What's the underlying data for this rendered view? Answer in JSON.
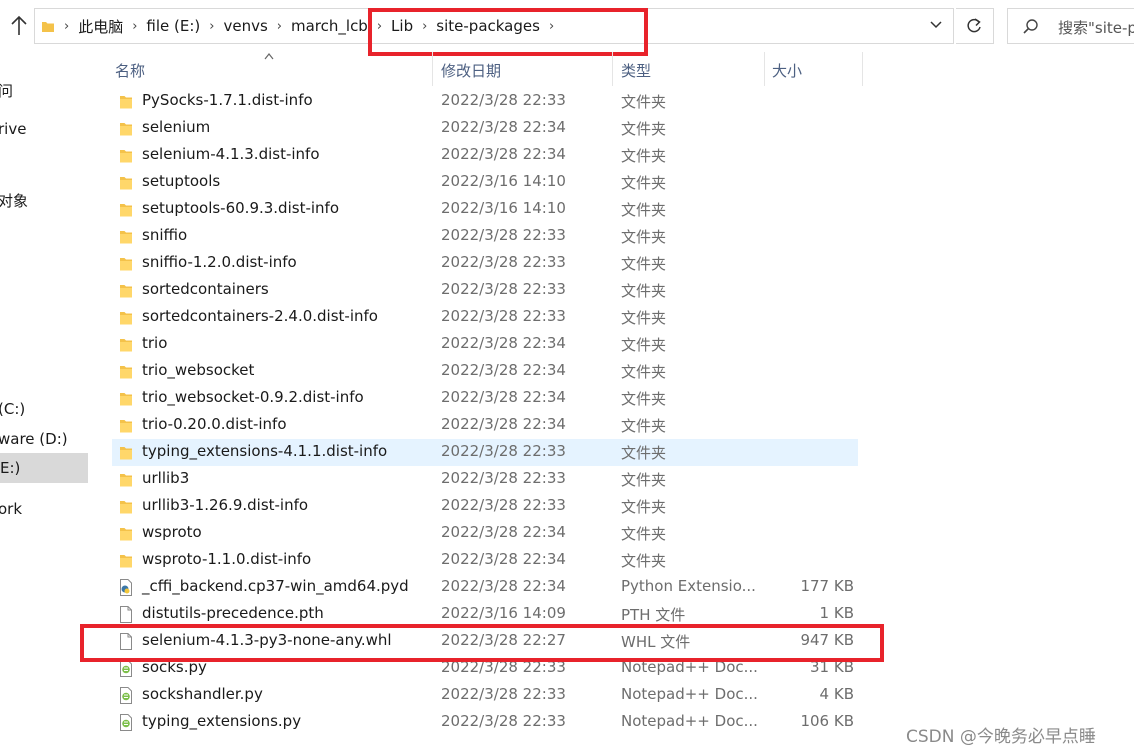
{
  "breadcrumb": [
    "此电脑",
    "file (E:)",
    "venvs",
    "march_lcb",
    "Lib",
    "site-packages"
  ],
  "search": {
    "placeholder": "搜索\"site-p"
  },
  "nav": {
    "items": [
      {
        "label": "问"
      },
      {
        "label": "rive"
      },
      {
        "label": "对象"
      },
      {
        "label": "(C:)"
      },
      {
        "label": "ware (D:)"
      },
      {
        "label": "E:)"
      },
      {
        "label": "ork"
      }
    ]
  },
  "columns": {
    "name": "名称",
    "date": "修改日期",
    "type": "类型",
    "size": "大小"
  },
  "files": [
    {
      "name": "PySocks-1.7.1.dist-info",
      "date": "2022/3/28 22:33",
      "type": "文件夹",
      "size": "",
      "icon": "folder-icon"
    },
    {
      "name": "selenium",
      "date": "2022/3/28 22:34",
      "type": "文件夹",
      "size": "",
      "icon": "folder-icon"
    },
    {
      "name": "selenium-4.1.3.dist-info",
      "date": "2022/3/28 22:34",
      "type": "文件夹",
      "size": "",
      "icon": "folder-icon"
    },
    {
      "name": "setuptools",
      "date": "2022/3/16 14:10",
      "type": "文件夹",
      "size": "",
      "icon": "folder-icon"
    },
    {
      "name": "setuptools-60.9.3.dist-info",
      "date": "2022/3/16 14:10",
      "type": "文件夹",
      "size": "",
      "icon": "folder-icon"
    },
    {
      "name": "sniffio",
      "date": "2022/3/28 22:33",
      "type": "文件夹",
      "size": "",
      "icon": "folder-icon"
    },
    {
      "name": "sniffio-1.2.0.dist-info",
      "date": "2022/3/28 22:33",
      "type": "文件夹",
      "size": "",
      "icon": "folder-icon"
    },
    {
      "name": "sortedcontainers",
      "date": "2022/3/28 22:33",
      "type": "文件夹",
      "size": "",
      "icon": "folder-icon"
    },
    {
      "name": "sortedcontainers-2.4.0.dist-info",
      "date": "2022/3/28 22:33",
      "type": "文件夹",
      "size": "",
      "icon": "folder-icon"
    },
    {
      "name": "trio",
      "date": "2022/3/28 22:34",
      "type": "文件夹",
      "size": "",
      "icon": "folder-icon"
    },
    {
      "name": "trio_websocket",
      "date": "2022/3/28 22:34",
      "type": "文件夹",
      "size": "",
      "icon": "folder-icon"
    },
    {
      "name": "trio_websocket-0.9.2.dist-info",
      "date": "2022/3/28 22:34",
      "type": "文件夹",
      "size": "",
      "icon": "folder-icon"
    },
    {
      "name": "trio-0.20.0.dist-info",
      "date": "2022/3/28 22:34",
      "type": "文件夹",
      "size": "",
      "icon": "folder-icon"
    },
    {
      "name": "typing_extensions-4.1.1.dist-info",
      "date": "2022/3/28 22:33",
      "type": "文件夹",
      "size": "",
      "icon": "folder-icon"
    },
    {
      "name": "urllib3",
      "date": "2022/3/28 22:33",
      "type": "文件夹",
      "size": "",
      "icon": "folder-icon"
    },
    {
      "name": "urllib3-1.26.9.dist-info",
      "date": "2022/3/28 22:33",
      "type": "文件夹",
      "size": "",
      "icon": "folder-icon"
    },
    {
      "name": "wsproto",
      "date": "2022/3/28 22:34",
      "type": "文件夹",
      "size": "",
      "icon": "folder-icon"
    },
    {
      "name": "wsproto-1.1.0.dist-info",
      "date": "2022/3/28 22:34",
      "type": "文件夹",
      "size": "",
      "icon": "folder-icon"
    },
    {
      "name": "_cffi_backend.cp37-win_amd64.pyd",
      "date": "2022/3/28 22:34",
      "type": "Python Extensio...",
      "size": "177 KB",
      "icon": "python-extension-icon"
    },
    {
      "name": "distutils-precedence.pth",
      "date": "2022/3/16 14:09",
      "type": "PTH 文件",
      "size": "1 KB",
      "icon": "file-icon"
    },
    {
      "name": "selenium-4.1.3-py3-none-any.whl",
      "date": "2022/3/28 22:27",
      "type": "WHL 文件",
      "size": "947 KB",
      "icon": "file-icon"
    },
    {
      "name": "socks.py",
      "date": "2022/3/28 22:33",
      "type": "Notepad++ Doc...",
      "size": "31 KB",
      "icon": "notepadpp-document-icon"
    },
    {
      "name": "sockshandler.py",
      "date": "2022/3/28 22:33",
      "type": "Notepad++ Doc...",
      "size": "4 KB",
      "icon": "notepadpp-document-icon"
    },
    {
      "name": "typing_extensions.py",
      "date": "2022/3/28 22:33",
      "type": "Notepad++ Doc...",
      "size": "106 KB",
      "icon": "notepadpp-document-icon"
    }
  ],
  "watermark": "CSDN @今晚务必早点睡",
  "colors": {
    "annotation": "#e8232b",
    "hover_row": "#e5f3ff",
    "folder": "#f4c24a",
    "header_text": "#4d6082"
  }
}
